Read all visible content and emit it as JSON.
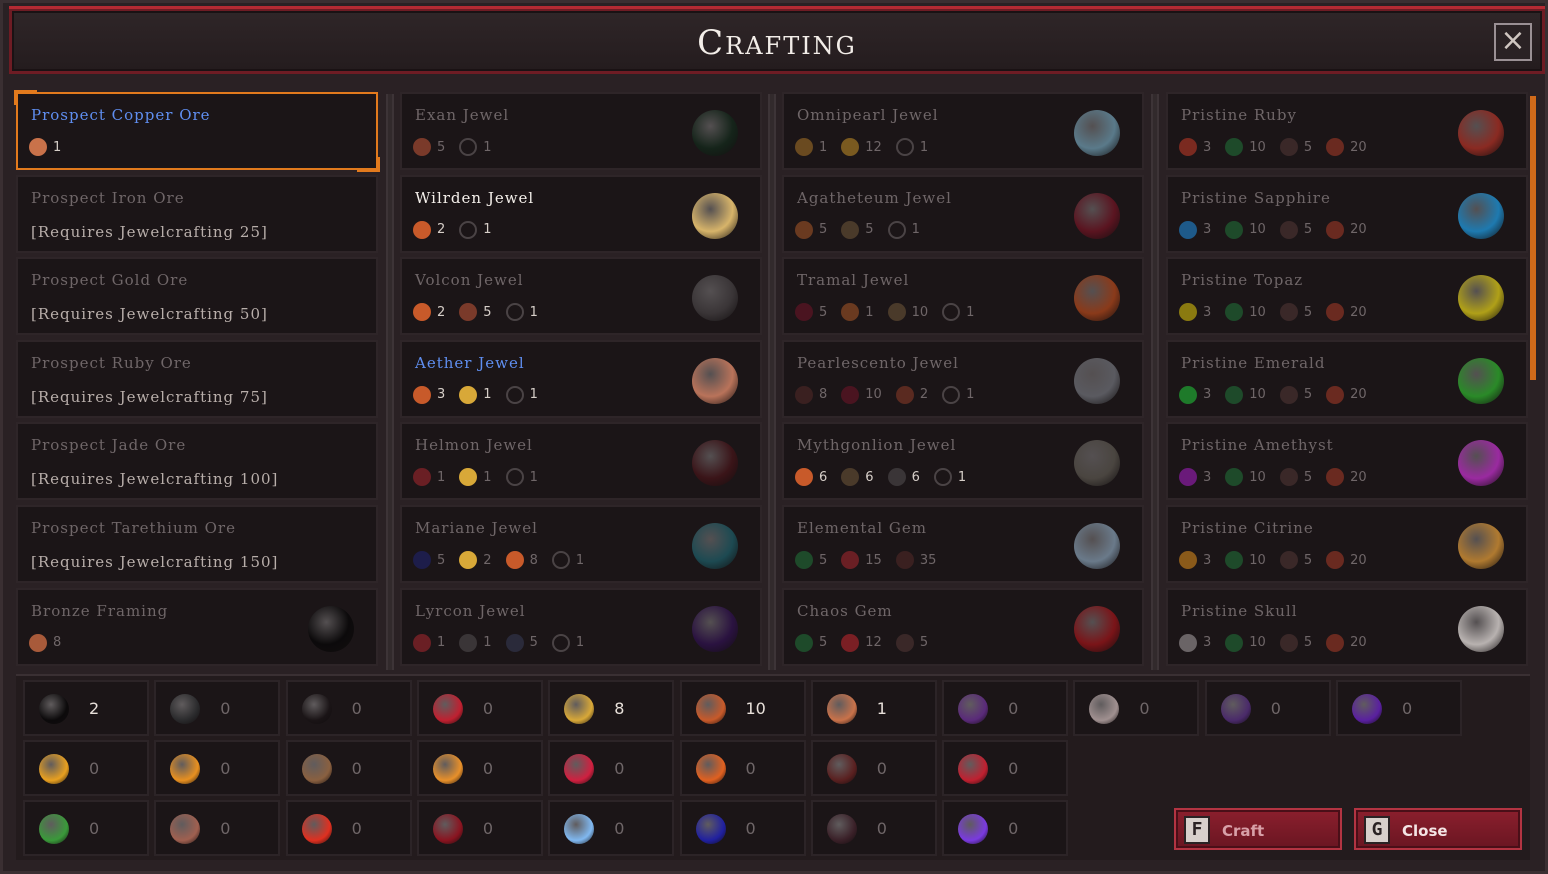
{
  "window": {
    "title": "Crafting",
    "close_icon": "×"
  },
  "columns": [
    {
      "items": [
        {
          "name": "Prospect Copper Ore",
          "style": "blue bright",
          "selected": true,
          "mats": [
            {
              "icon": "copper-ore",
              "color": "#c9724a",
              "count": "1"
            }
          ]
        },
        {
          "name": "Prospect Iron Ore",
          "req": "[Requires Jewelcrafting 25]"
        },
        {
          "name": "Prospect Gold Ore",
          "req": "[Requires Jewelcrafting 50]"
        },
        {
          "name": "Prospect Ruby Ore",
          "req": "[Requires Jewelcrafting 75]"
        },
        {
          "name": "Prospect Jade Ore",
          "req": "[Requires Jewelcrafting 100]"
        },
        {
          "name": "Prospect Tarethium Ore",
          "req": "[Requires Jewelcrafting 150]"
        },
        {
          "name": "Bronze Framing",
          "mats": [
            {
              "icon": "copper-ore",
              "color": "#a85a3a",
              "count": "8"
            }
          ],
          "big": {
            "icon": "framing",
            "color": "#0c0a0b"
          }
        }
      ]
    },
    {
      "items": [
        {
          "name": "Exan Jewel",
          "mats": [
            {
              "icon": "copper-ore",
              "color": "#7a3a2a",
              "count": "5"
            },
            {
              "icon": "framing",
              "ring": true,
              "count": "1"
            }
          ],
          "big": {
            "icon": "exan-jewel",
            "color": "#15241a"
          }
        },
        {
          "name": "Wilrden Jewel",
          "style": "white bright",
          "mats": [
            {
              "icon": "ore",
              "color": "#c85a2a",
              "count": "2"
            },
            {
              "icon": "framing",
              "ring": true,
              "count": "1"
            }
          ],
          "big": {
            "icon": "wilrden-jewel",
            "color": "#d7b46a"
          }
        },
        {
          "name": "Volcon Jewel",
          "style": "bright",
          "mats": [
            {
              "icon": "ore",
              "color": "#c85a2a",
              "count": "2"
            },
            {
              "icon": "copper-ore",
              "color": "#7a3a2a",
              "count": "5"
            },
            {
              "icon": "framing",
              "ring": true,
              "count": "1"
            }
          ],
          "big": {
            "icon": "volcon-jewel",
            "color": "#3a3537"
          }
        },
        {
          "name": "Aether Jewel",
          "style": "blue bright",
          "mats": [
            {
              "icon": "ore",
              "color": "#c85a2a",
              "count": "3"
            },
            {
              "icon": "feather",
              "color": "#d8a838",
              "count": "1"
            },
            {
              "icon": "framing",
              "ring": true,
              "count": "1"
            }
          ],
          "big": {
            "icon": "aether-jewel",
            "color": "#b9735a"
          }
        },
        {
          "name": "Helmon Jewel",
          "mats": [
            {
              "icon": "shard",
              "color": "#6a1f24",
              "count": "1"
            },
            {
              "icon": "feather",
              "color": "#d8a838",
              "count": "1"
            },
            {
              "icon": "framing",
              "ring": true,
              "count": "1"
            }
          ],
          "big": {
            "icon": "helmon-jewel",
            "color": "#3a1418"
          }
        },
        {
          "name": "Mariane Jewel",
          "mats": [
            {
              "icon": "crystal",
              "color": "#1d1d4a",
              "count": "5"
            },
            {
              "icon": "feather",
              "color": "#d8a838",
              "count": "2"
            },
            {
              "icon": "ore",
              "color": "#c85a2a",
              "count": "8"
            },
            {
              "icon": "framing",
              "ring": true,
              "count": "1"
            }
          ],
          "big": {
            "icon": "mariane-jewel",
            "color": "#1d4a52"
          }
        },
        {
          "name": "Lyrcon Jewel",
          "mats": [
            {
              "icon": "shard",
              "color": "#6a1f24",
              "count": "1"
            },
            {
              "icon": "blade",
              "color": "#3a3537",
              "count": "1"
            },
            {
              "icon": "crystal",
              "color": "#2a2a3a",
              "count": "5"
            },
            {
              "icon": "framing",
              "ring": true,
              "count": "1"
            }
          ],
          "big": {
            "icon": "lyrcon-jewel",
            "color": "#2a1240"
          }
        }
      ]
    },
    {
      "items": [
        {
          "name": "Omnipearl Jewel",
          "mats": [
            {
              "icon": "amber",
              "color": "#6a4a20",
              "count": "1"
            },
            {
              "icon": "plank",
              "color": "#7a5a20",
              "count": "12"
            },
            {
              "icon": "compass",
              "ring": true,
              "count": "1"
            }
          ],
          "big": {
            "icon": "omnipearl-jewel",
            "color": "#5a7a8a"
          }
        },
        {
          "name": "Agatheteum Jewel",
          "mats": [
            {
              "icon": "bread",
              "color": "#6a3a20",
              "count": "5"
            },
            {
              "icon": "nut",
              "color": "#4a3a2a",
              "count": "5"
            },
            {
              "icon": "compass",
              "ring": true,
              "count": "1"
            }
          ],
          "big": {
            "icon": "agatheteum-jewel",
            "color": "#5a1420"
          }
        },
        {
          "name": "Tramal Jewel",
          "mats": [
            {
              "icon": "star",
              "color": "#4a1420",
              "count": "5"
            },
            {
              "icon": "bread",
              "color": "#6a3a20",
              "count": "1"
            },
            {
              "icon": "nut",
              "color": "#4a3a2a",
              "count": "10"
            },
            {
              "icon": "compass",
              "ring": true,
              "count": "1"
            }
          ],
          "big": {
            "icon": "tramal-jewel",
            "color": "#8a3a1a"
          }
        },
        {
          "name": "Pearlescento Jewel",
          "mats": [
            {
              "icon": "claw",
              "color": "#3a2020",
              "count": "8"
            },
            {
              "icon": "shard",
              "color": "#4a1420",
              "count": "10"
            },
            {
              "icon": "flame",
              "color": "#5a2a20",
              "count": "2"
            },
            {
              "icon": "framing",
              "ring": true,
              "count": "1"
            }
          ],
          "big": {
            "icon": "pearlescento-jewel",
            "color": "#5a5a60"
          }
        },
        {
          "name": "Mythgonlion Jewel",
          "style": "bright",
          "mats": [
            {
              "icon": "ore",
              "color": "#c85a2a",
              "count": "6"
            },
            {
              "icon": "nut",
              "color": "#4a3a2a",
              "count": "6"
            },
            {
              "icon": "blade",
              "color": "#3a3537",
              "count": "6"
            },
            {
              "icon": "framing",
              "ring": true,
              "count": "1"
            }
          ],
          "big": {
            "icon": "mythgonlion-jewel",
            "color": "#4a4540"
          }
        },
        {
          "name": "Elemental Gem",
          "mats": [
            {
              "icon": "leaf",
              "color": "#1e4a2a",
              "count": "5"
            },
            {
              "icon": "berry",
              "color": "#6a1f24",
              "count": "15"
            },
            {
              "icon": "star",
              "color": "#3a2020",
              "count": "35"
            }
          ],
          "big": {
            "icon": "elemental-gem",
            "color": "#6a7a8a"
          }
        },
        {
          "name": "Chaos Gem",
          "mats": [
            {
              "icon": "leaf",
              "color": "#1e4a2a",
              "count": "5"
            },
            {
              "icon": "berry",
              "color": "#7a1f24",
              "count": "12"
            },
            {
              "icon": "claw",
              "color": "#3a2828",
              "count": "5"
            }
          ],
          "big": {
            "icon": "chaos-gem",
            "color": "#7a1418"
          }
        }
      ]
    },
    {
      "items": [
        {
          "name": "Pristine Ruby",
          "mats": [
            {
              "icon": "ruby",
              "color": "#7a2a20",
              "count": "3"
            },
            {
              "icon": "leaf",
              "color": "#1e4a2a",
              "count": "10"
            },
            {
              "icon": "claw",
              "color": "#3a2828",
              "count": "5"
            },
            {
              "icon": "flame",
              "color": "#6a2a20",
              "count": "20"
            }
          ],
          "big": {
            "icon": "pristine-ruby",
            "color": "#8a2a22"
          }
        },
        {
          "name": "Pristine Sapphire",
          "mats": [
            {
              "icon": "sapphire",
              "color": "#1e5a8a",
              "count": "3"
            },
            {
              "icon": "leaf",
              "color": "#1e4a2a",
              "count": "10"
            },
            {
              "icon": "claw",
              "color": "#3a2828",
              "count": "5"
            },
            {
              "icon": "flame",
              "color": "#6a2a20",
              "count": "20"
            }
          ],
          "big": {
            "icon": "pristine-sapphire",
            "color": "#1e7ab0"
          }
        },
        {
          "name": "Pristine Topaz",
          "mats": [
            {
              "icon": "topaz",
              "color": "#8a7a10",
              "count": "3"
            },
            {
              "icon": "leaf",
              "color": "#1e4a2a",
              "count": "10"
            },
            {
              "icon": "claw",
              "color": "#3a2828",
              "count": "5"
            },
            {
              "icon": "flame",
              "color": "#6a2a20",
              "count": "20"
            }
          ],
          "big": {
            "icon": "pristine-topaz",
            "color": "#b0a018"
          }
        },
        {
          "name": "Pristine Emerald",
          "mats": [
            {
              "icon": "emerald",
              "color": "#1e7a2a",
              "count": "3"
            },
            {
              "icon": "leaf",
              "color": "#1e4a2a",
              "count": "10"
            },
            {
              "icon": "claw",
              "color": "#3a2828",
              "count": "5"
            },
            {
              "icon": "flame",
              "color": "#6a2a20",
              "count": "20"
            }
          ],
          "big": {
            "icon": "pristine-emerald",
            "color": "#2a8a28"
          }
        },
        {
          "name": "Pristine Amethyst",
          "mats": [
            {
              "icon": "amethyst",
              "color": "#6a1a7a",
              "count": "3"
            },
            {
              "icon": "leaf",
              "color": "#1e4a2a",
              "count": "10"
            },
            {
              "icon": "claw",
              "color": "#3a2828",
              "count": "5"
            },
            {
              "icon": "flame",
              "color": "#6a2a20",
              "count": "20"
            }
          ],
          "big": {
            "icon": "pristine-amethyst",
            "color": "#9a2aa0"
          }
        },
        {
          "name": "Pristine Citrine",
          "mats": [
            {
              "icon": "citrine",
              "color": "#8a5a1a",
              "count": "3"
            },
            {
              "icon": "leaf",
              "color": "#1e4a2a",
              "count": "10"
            },
            {
              "icon": "claw",
              "color": "#3a2828",
              "count": "5"
            },
            {
              "icon": "flame",
              "color": "#6a2a20",
              "count": "20"
            }
          ],
          "big": {
            "icon": "pristine-citrine",
            "color": "#b07a30"
          }
        },
        {
          "name": "Pristine Skull",
          "mats": [
            {
              "icon": "skull",
              "color": "#6a6466",
              "count": "3"
            },
            {
              "icon": "leaf",
              "color": "#1e4a2a",
              "count": "10"
            },
            {
              "icon": "claw",
              "color": "#3a2828",
              "count": "5"
            },
            {
              "icon": "flame",
              "color": "#6a2a20",
              "count": "20"
            }
          ],
          "big": {
            "icon": "pristine-skull",
            "color": "#b8b2b0"
          }
        }
      ]
    }
  ],
  "inventory": [
    [
      {
        "icon": "framing",
        "color": "#0c0a0b",
        "count": "2"
      },
      {
        "icon": "compass",
        "color": "#2a2a2c",
        "count": "0"
      },
      {
        "icon": "square-frame",
        "color": "#1a1416",
        "count": "0"
      },
      {
        "icon": "red-shard",
        "color": "#c02030",
        "count": "0"
      },
      {
        "icon": "feather",
        "color": "#d8a838",
        "count": "8"
      },
      {
        "icon": "ore",
        "color": "#c85a2a",
        "count": "10"
      },
      {
        "icon": "copper-ore",
        "color": "#c9724a",
        "count": "1"
      },
      {
        "icon": "purple-vial",
        "color": "#5a2a7a",
        "count": "0"
      },
      {
        "icon": "shell",
        "color": "#a09090",
        "count": "0"
      },
      {
        "icon": "dark-crystal",
        "color": "#4a2a6a",
        "count": "0"
      },
      {
        "icon": "violet-ore",
        "color": "#5a20a0",
        "count": "0"
      }
    ],
    [
      {
        "icon": "amber-crystal",
        "color": "#e8a020",
        "count": "0"
      },
      {
        "icon": "bread",
        "color": "#e89020",
        "count": "0"
      },
      {
        "icon": "nut",
        "color": "#8a6040",
        "count": "0"
      },
      {
        "icon": "plank",
        "color": "#e8902a",
        "count": "0"
      },
      {
        "icon": "ruby-cluster",
        "color": "#d02040",
        "count": "0"
      },
      {
        "icon": "flame",
        "color": "#e06020",
        "count": "0"
      },
      {
        "icon": "claw",
        "color": "#5a2020",
        "count": "0"
      },
      {
        "icon": "red-star",
        "color": "#c02030",
        "count": "0"
      }
    ],
    [
      {
        "icon": "leaf",
        "color": "#3a9a3a",
        "count": "0"
      },
      {
        "icon": "fang",
        "color": "#a06050",
        "count": "0"
      },
      {
        "icon": "berry",
        "color": "#e03020",
        "count": "0"
      },
      {
        "icon": "thorn",
        "color": "#8a1420",
        "count": "0"
      },
      {
        "icon": "ice-crystal",
        "color": "#80b8f0",
        "count": "0"
      },
      {
        "icon": "blue-orb",
        "color": "#2020a0",
        "count": "0"
      },
      {
        "icon": "dark-blade",
        "color": "#3a2028",
        "count": "0"
      },
      {
        "icon": "violet-gem",
        "color": "#7a3ae0",
        "count": "0"
      }
    ]
  ],
  "buttons": {
    "craft": {
      "key": "F",
      "label": "Craft"
    },
    "close": {
      "key": "G",
      "label": "Close"
    }
  },
  "colors": {
    "accent": "#e27a1d",
    "button_red": "#8b1f2d",
    "craft_text": "#d8a0a8",
    "close_text": "#f4e4e4"
  }
}
